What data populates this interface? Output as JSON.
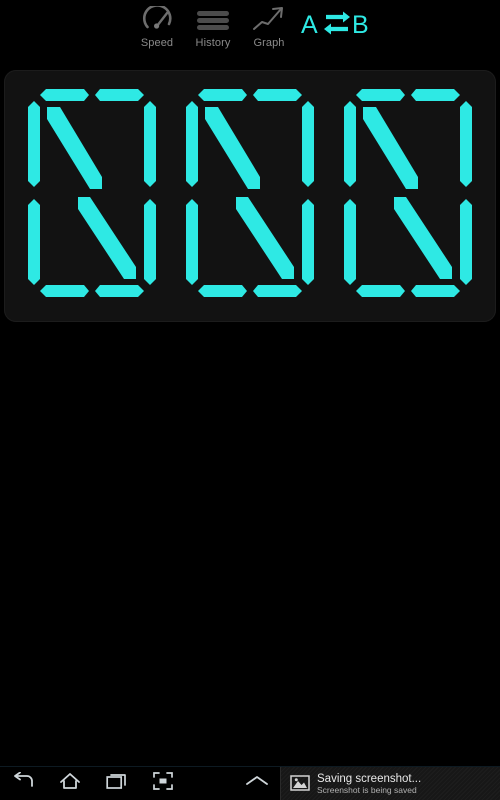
{
  "app": {
    "background": "#000000",
    "accent": "#2ee9e4"
  },
  "toolbar": {
    "items": [
      {
        "id": "speed",
        "label": "Speed",
        "icon": "speedometer-icon"
      },
      {
        "id": "history",
        "label": "History",
        "icon": "list-lines-icon"
      },
      {
        "id": "graph",
        "label": "Graph",
        "icon": "trend-up-arrow-icon"
      }
    ],
    "ab_toggle": {
      "icon": "a-b-swap-icon",
      "left_letter": "A",
      "right_letter": "B",
      "color": "#2ee9e4"
    }
  },
  "display": {
    "panel_color": "#121212",
    "segment_on_color": "#2ee9e4",
    "segment_off_color": "#101010",
    "digit_count": 3,
    "pattern": "all-segments-test",
    "digits": [
      {
        "index": 0,
        "value": "8",
        "segments_on": [
          "A1",
          "A2",
          "F",
          "B",
          "H",
          "M",
          "E",
          "C",
          "D1",
          "D2"
        ]
      },
      {
        "index": 1,
        "value": "8",
        "segments_on": [
          "A1",
          "A2",
          "F",
          "B",
          "H",
          "M",
          "E",
          "C",
          "D1",
          "D2"
        ]
      },
      {
        "index": 2,
        "value": "8",
        "segments_on": [
          "A1",
          "A2",
          "F",
          "B",
          "H",
          "M",
          "E",
          "C",
          "D1",
          "D2"
        ]
      }
    ]
  },
  "navbar": {
    "buttons": [
      {
        "id": "back",
        "icon": "back-arrow-icon"
      },
      {
        "id": "home",
        "icon": "home-icon"
      },
      {
        "id": "recents",
        "icon": "recent-apps-icon"
      },
      {
        "id": "screenshot",
        "icon": "screenshot-capture-icon"
      },
      {
        "id": "expand",
        "icon": "chevron-up-icon"
      }
    ],
    "notification": {
      "icon": "image-file-icon",
      "title": "Saving screenshot...",
      "subtitle": "Screenshot is being saved"
    }
  }
}
